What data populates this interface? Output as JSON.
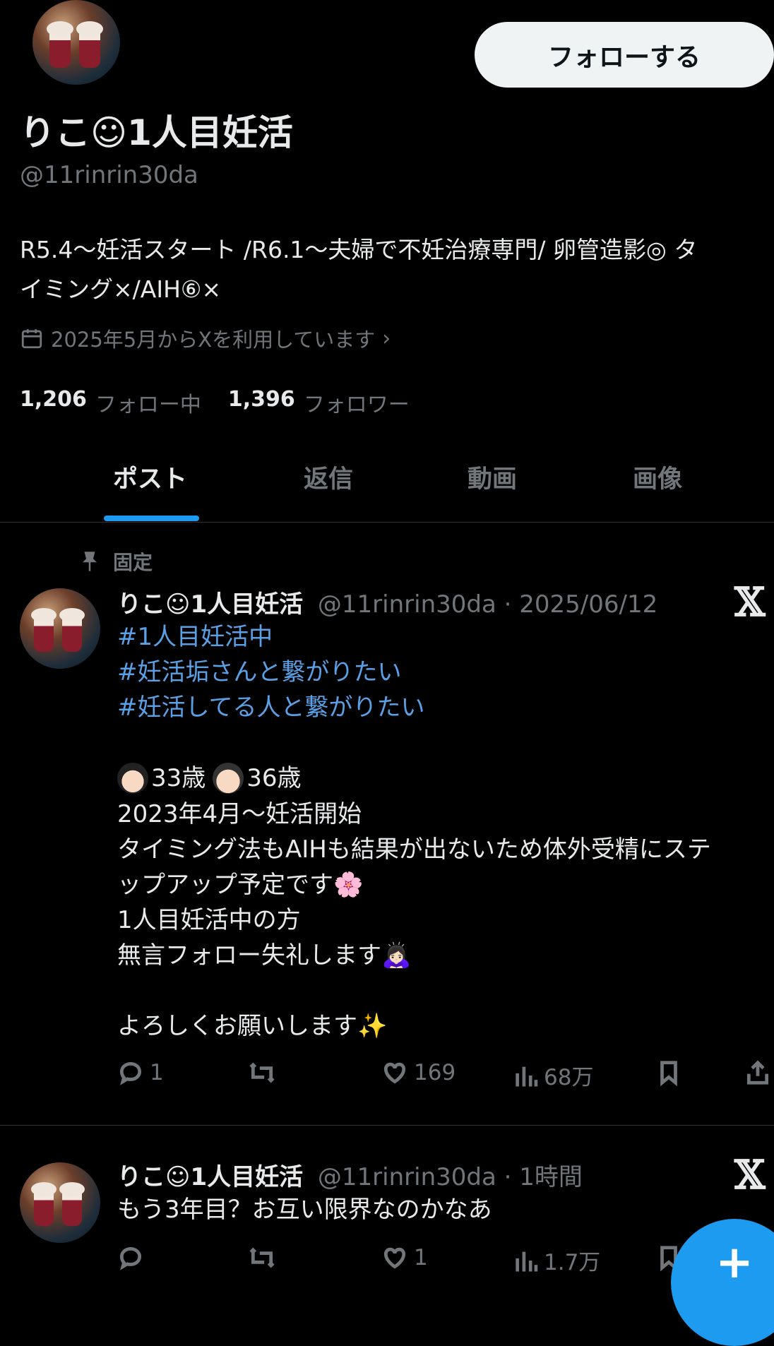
{
  "profile": {
    "follow_label": "フォローする",
    "display_name": "りこ☺1人目妊活",
    "handle": "@11rinrin30da",
    "bio_line1": "R5.4〜妊活スタート /R6.1〜夫婦で不妊治療専門/ 卵管造影◎ タ",
    "bio_line2": "イミング×/AIH⑥×",
    "joined": "2025年5月からXを利用しています",
    "following_count": "1,206",
    "following_label": "フォロー中",
    "followers_count": "1,396",
    "followers_label": "フォロワー"
  },
  "tabs": [
    {
      "label": "ポスト"
    },
    {
      "label": "返信"
    },
    {
      "label": "動画"
    },
    {
      "label": "画像"
    }
  ],
  "posts": [
    {
      "pinned_label": "固定",
      "name": "りこ☺1人目妊活",
      "meta": "@11rinrin30da · 2025/06/12",
      "hashtags": [
        "#1人目妊活中",
        "#妊活垢さんと繋がりたい",
        "#妊活してる人と繋がりたい"
      ],
      "ages_line_a": "33歳",
      "ages_line_b": "36歳",
      "body": "2023年4月〜妊活開始\nタイミング法もAIHも結果が出ないため体外受精にステ\nップアップ予定です🌸\n1人目妊活中の方\n無言フォロー失礼します🙇🏻‍♀️\n\nよろしくお願いします✨",
      "replies": "1",
      "reposts": "",
      "likes": "169",
      "views": "68万"
    },
    {
      "name": "りこ☺1人目妊活",
      "meta": "@11rinrin30da · 1時間",
      "body": "もう3年目？お互い限界なのかなあ",
      "replies": "",
      "reposts": "",
      "likes": "1",
      "views": "1.7万"
    }
  ],
  "icons": {
    "x_logo": "𝕏",
    "calendar": "calendar-icon",
    "pin": "pin-icon",
    "compose": "+"
  },
  "colors": {
    "accent": "#1d9bf0",
    "hashtag": "#5aa0e6",
    "muted": "#71767b"
  }
}
